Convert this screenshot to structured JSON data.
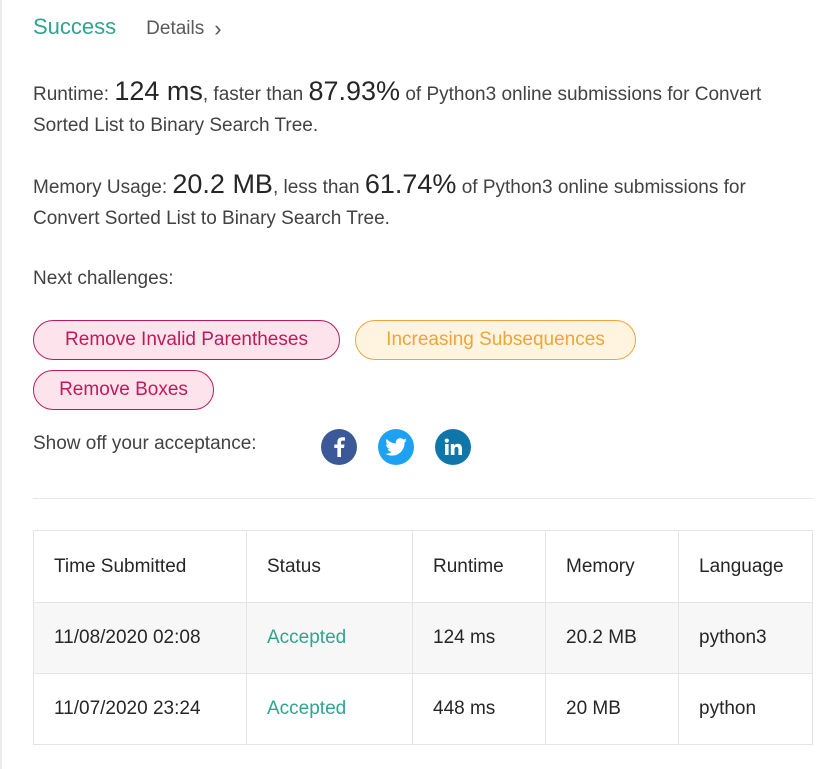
{
  "header": {
    "status": "Success",
    "details_label": "Details",
    "details_chevron": "›"
  },
  "runtime": {
    "label": "Runtime:",
    "value": "124 ms",
    "mid": ", faster than",
    "percent": "87.93%",
    "tail": "of Python3 online submissions for Convert Sorted List to Binary Search Tree."
  },
  "memory": {
    "label": "Memory Usage:",
    "value": "20.2 MB",
    "mid": ", less than",
    "percent": "61.74%",
    "tail": "of Python3 online submissions for Convert Sorted List to Binary Search Tree."
  },
  "challenges": {
    "label": "Next challenges:",
    "items": [
      {
        "label": "Remove Invalid Parentheses",
        "difficulty": "hard"
      },
      {
        "label": "Increasing Subsequences",
        "difficulty": "medium"
      },
      {
        "label": "Remove Boxes",
        "difficulty": "hard"
      }
    ]
  },
  "share": {
    "label": "Show off your acceptance:",
    "icons": [
      "facebook-icon",
      "twitter-icon",
      "linkedin-icon"
    ]
  },
  "table": {
    "headers": [
      "Time Submitted",
      "Status",
      "Runtime",
      "Memory",
      "Language"
    ],
    "rows": [
      [
        "11/08/2020 02:08",
        "Accepted",
        "124 ms",
        "20.2 MB",
        "python3"
      ],
      [
        "11/07/2020 23:24",
        "Accepted",
        "448 ms",
        "20 MB",
        "python"
      ]
    ]
  },
  "colors": {
    "accent": "#2ea58f",
    "hard": "#c2185b",
    "medium": "#f0a43a",
    "facebook": "#3b5998",
    "twitter": "#1da1f2",
    "linkedin": "#0e76a8"
  }
}
